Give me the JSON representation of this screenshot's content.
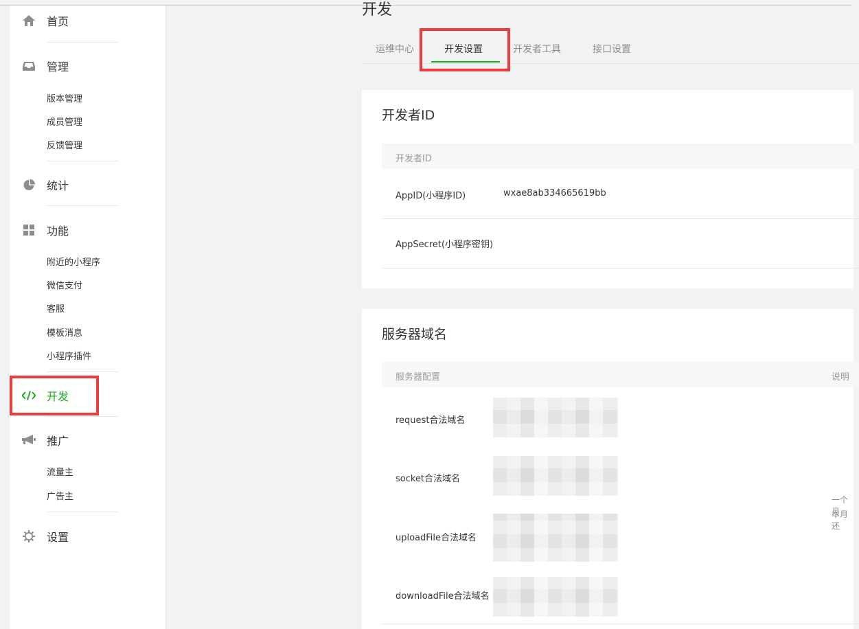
{
  "sidebar": {
    "home": "首页",
    "manage": "管理",
    "manage_items": [
      "版本管理",
      "成员管理",
      "反馈管理"
    ],
    "stats": "统计",
    "features": "功能",
    "feature_items": [
      "附近的小程序",
      "微信支付",
      "客服",
      "模板消息",
      "小程序插件"
    ],
    "dev": "开发",
    "promote": "推广",
    "promote_items": [
      "流量主",
      "广告主"
    ],
    "settings": "设置"
  },
  "main": {
    "title": "开发",
    "tabs": [
      "运维中心",
      "开发设置",
      "开发者工具",
      "接口设置"
    ],
    "active_tab": "开发设置"
  },
  "developer_id": {
    "title": "开发者ID",
    "header": "开发者ID",
    "rows": [
      {
        "label": "AppID(小程序ID)",
        "value": "wxae8ab334665619bb"
      },
      {
        "label": "AppSecret(小程序密钥)",
        "value": ""
      }
    ]
  },
  "server_domain": {
    "title": "服务器域名",
    "header_config": "服务器配置",
    "header_note": "说明",
    "rows": [
      {
        "label": "request合法域名"
      },
      {
        "label": "socket合法域名"
      },
      {
        "label": "uploadFile合法域名"
      },
      {
        "label": "downloadFile合法域名"
      }
    ],
    "note_line1": "一个月",
    "note_line2": "本月还"
  },
  "colors": {
    "accent": "#1aad19",
    "highlight": "#ef3c3a"
  }
}
